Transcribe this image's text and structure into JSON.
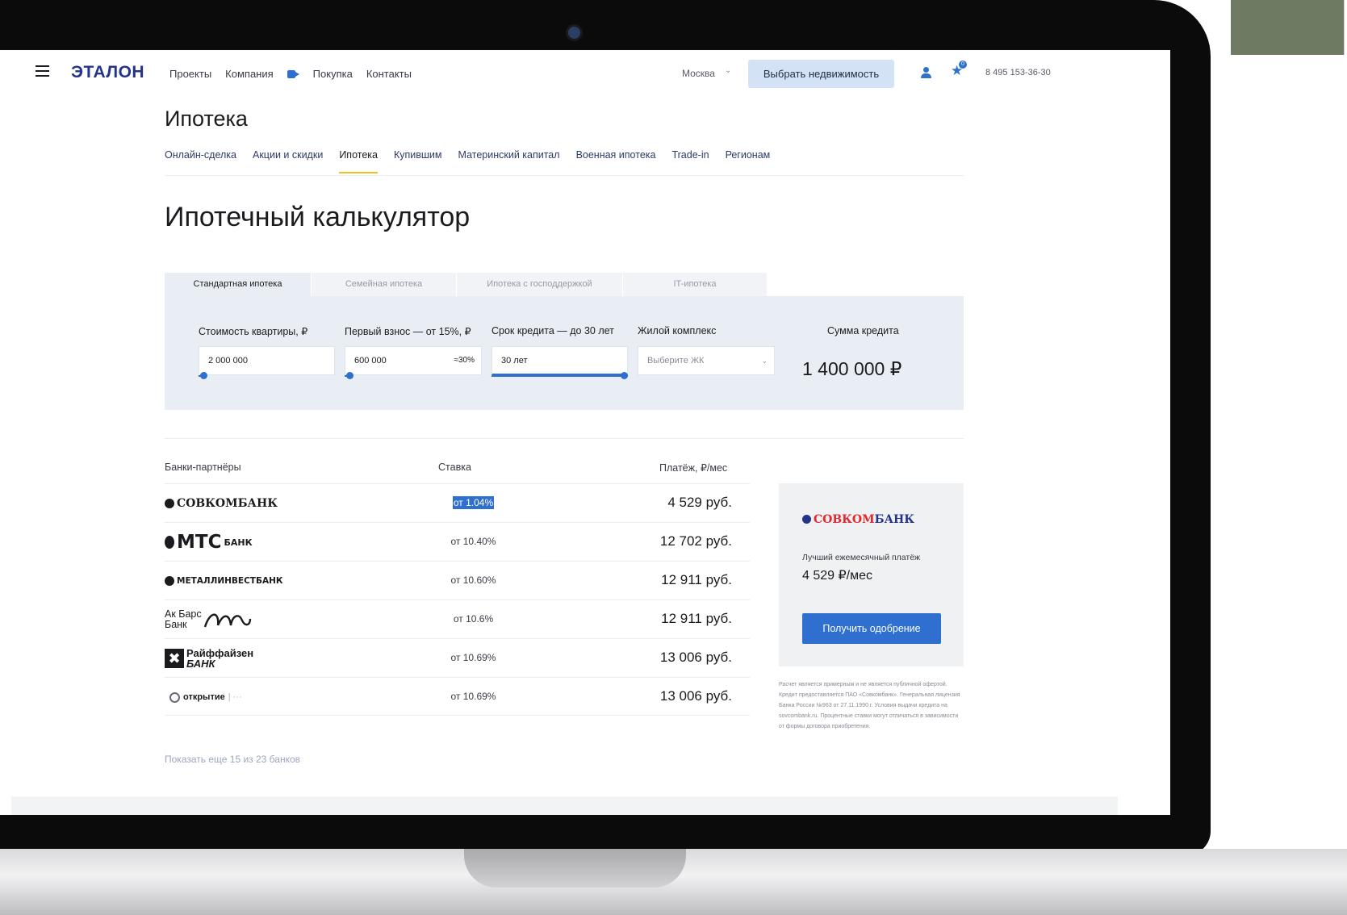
{
  "header": {
    "logo": "ЭТАЛОН",
    "nav": [
      "Проекты",
      "Компания",
      "Покупка",
      "Контакты"
    ],
    "city": "Москва",
    "choose_button": "Выбрать недвижимость",
    "favorites_count": "0",
    "phone": "8 495 153-36-30"
  },
  "page": {
    "title": "Ипотека",
    "subnav": [
      "Онлайн-сделка",
      "Акции и скидки",
      "Ипотека",
      "Купившим",
      "Материнский капитал",
      "Военная ипотека",
      "Trade-in",
      "Регионам"
    ],
    "active_subnav": "Ипотека"
  },
  "calculator": {
    "title": "Ипотечный калькулятор",
    "tabs": [
      "Стандартная ипотека",
      "Семейная ипотека",
      "Ипотека с господдержкой",
      "IT-ипотека"
    ],
    "active_tab": "Стандартная ипотека",
    "price_label": "Стоимость квартиры, ₽",
    "price_value": "2 000 000",
    "down_label": "Первый взнос — от 15%, ₽",
    "down_value": "600 000",
    "down_percent": "≈30%",
    "term_label": "Срок кредита — до 30 лет",
    "term_value": "30 лет",
    "complex_label": "Жилой комплекс",
    "complex_placeholder": "Выберите ЖК",
    "loan_label": "Сумма кредита",
    "loan_amount": "1 400 000 ₽",
    "sliders": {
      "price_fraction": 0.0,
      "down_fraction": 0.0,
      "term_fraction": 1.0
    }
  },
  "banks_table": {
    "headers": [
      "Банки-партнёры",
      "Ставка",
      "Платёж, ₽/мес"
    ],
    "rows": [
      {
        "bank": "СОВКОМБАНК",
        "rate": "от 1.04%",
        "payment": "4 529 руб.",
        "highlighted": true
      },
      {
        "bank": "МТС",
        "bank_sub": "БАНК",
        "rate": "от 10.40%",
        "payment": "12 702 руб."
      },
      {
        "bank": "МЕТАЛЛИНВЕСТБАНК",
        "rate": "от 10.60%",
        "payment": "12 911 руб."
      },
      {
        "bank": "Ак Барс",
        "bank_sub": "Банк",
        "rate": "от 10.6%",
        "payment": "12 911 руб."
      },
      {
        "bank": "Райффайзен",
        "bank_sub": "БАНК",
        "rate": "от 10.69%",
        "payment": "13 006 руб."
      },
      {
        "bank": "открытие",
        "rate": "от 10.69%",
        "payment": "13 006 руб."
      }
    ],
    "show_more": "Показать еще 15 из 23 банков"
  },
  "best_offer": {
    "bank_red": "СОВКОМ",
    "bank_blue": "БАНК",
    "note": "Лучший ежемесячный платёж",
    "sum": "4 529 ₽/мес",
    "button": "Получить одобрение",
    "disclaimer": "Расчет является примерным и не является публичной офертой. Кредит предоставляется ПАО «Совкомбанк». Генеральная лицензия Банка России №963 от 27.11.1990 г. Условия выдачи кредита на sovcombank.ru. Процентные ставки могут отличаться в зависимости от формы договора приобретения."
  },
  "colors": {
    "brand": "#24348a",
    "accent": "#2f6fcf",
    "panel": "#e9eef4",
    "active_underline": "#f1c21b"
  }
}
